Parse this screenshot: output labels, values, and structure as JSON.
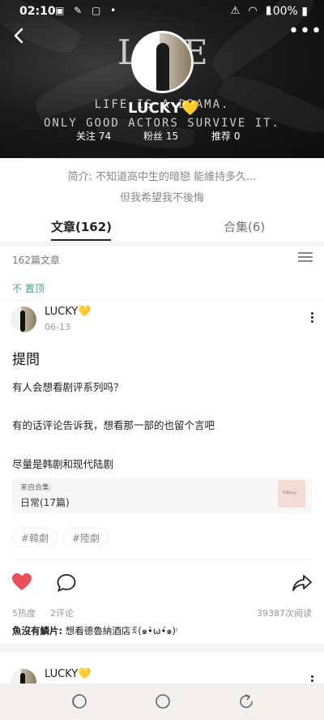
{
  "status_bar": {
    "time": "02:10",
    "left_icons": "▣ ✎ ▢ •",
    "right_icons": "⚠ ◠ ▮",
    "battery": "100%"
  },
  "profile": {
    "bg_letters": [
      "L",
      "E"
    ],
    "slogan_line1": "LIFE IS A DRAMA.",
    "slogan_line2": "ONLY GOOD ACTORS SURVIVE IT.",
    "name": "LUCKY",
    "name_emoji": "💛",
    "stats": [
      {
        "label": "关注",
        "value": "74"
      },
      {
        "label": "粉丝",
        "value": "15"
      },
      {
        "label": "推荐",
        "value": "0"
      }
    ],
    "bio_line1": "简介: 不知道高中生的暗戀 能維持多久...",
    "bio_line2": "但我希望我不後悔"
  },
  "tabs": {
    "articles": "文章(162)",
    "collections": "合集(6)"
  },
  "list_header": {
    "count": "162篇文章",
    "pin_label": "不 置顶"
  },
  "post": {
    "author": "LUCKY",
    "author_emoji": "💛",
    "date": "06-13",
    "title": "提問",
    "paragraphs": [
      "有人会想看剧评系列吗？",
      "有的话评论告诉我，想看那一部的也留个言吧",
      "尽量是韩剧和现代陆剧"
    ],
    "collection_from": "来自合集:",
    "collection_name": "日常(17篇)",
    "collection_thumb_text": "Tiffany",
    "tags": [
      "#韓劇",
      "#陸劇"
    ],
    "heat": "5热度",
    "comments": "2评论",
    "reads": "39387次阅读",
    "top_comment_user": "魚沒有鱗片:",
    "top_comment_text": " 想看德魯納酒店ꉂ(๑•̀ω•́๑)ᵎ"
  },
  "post2": {
    "author": "LUCKY",
    "author_emoji": "💛"
  },
  "colors": {
    "like": "#e8505b",
    "pin_green": "#4aa37a",
    "star_yellow": "#f6c400"
  }
}
